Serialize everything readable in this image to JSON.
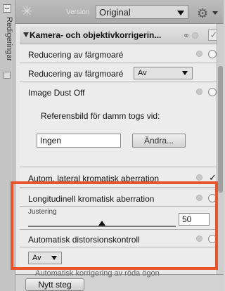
{
  "window": {
    "side_label": "Redigeringar",
    "version_label": "Version",
    "version_value": "Original"
  },
  "section": {
    "title": "Kamera- och objektivkorrigerin..."
  },
  "rows": {
    "moire_label": "Reducering av färgmoaré",
    "moire_select_label": "Reducering av färgmoaré",
    "moire_select_value": "Av",
    "dust_label": "Image Dust Off",
    "dust_ref_label": "Referensbild för damm togs vid:",
    "dust_ref_value": "Ingen",
    "change_button": "Ändra...",
    "lateral_label": "Autom. lateral kromatisk aberration",
    "longitudinal_label": "Longitudinell kromatisk aberration",
    "adjust_label": "Justering",
    "adjust_min": "0",
    "adjust_max": "100",
    "adjust_value": "50",
    "distortion_label": "Automatisk distorsionskontroll",
    "distortion_value": "Av",
    "cut_off_label": "Automatisk korrigering av röda ögon"
  },
  "footer": {
    "new_step_button": "Nytt steg"
  },
  "colors": {
    "highlight": "#e8542b"
  }
}
